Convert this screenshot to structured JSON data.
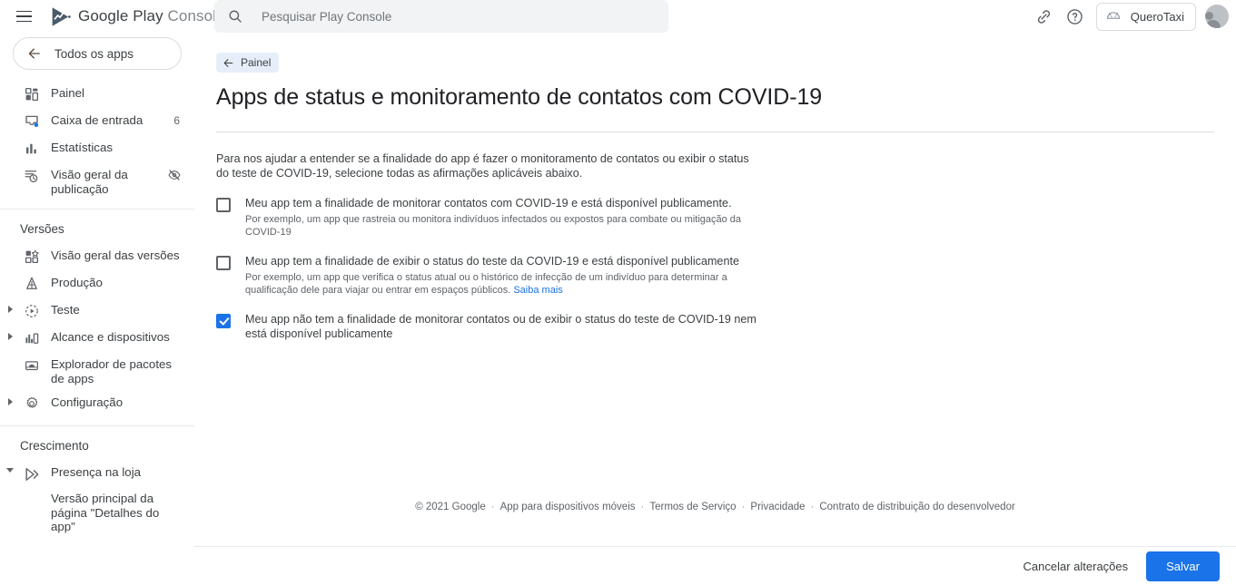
{
  "topbar": {
    "menu_icon": "hamburger-menu-icon",
    "brand_google_play": "Google Play",
    "brand_console": "Console",
    "logo_icon": "google-play-console-logo",
    "search": {
      "placeholder": "Pesquisar Play Console",
      "value": "",
      "icon": "search-icon"
    },
    "link_icon": "link-icon",
    "help_icon": "help-circle-icon",
    "app_chip": {
      "icon": "android-robot-icon",
      "name": "QueroTaxi"
    },
    "avatar": "user-avatar"
  },
  "sidebar": {
    "all_apps": {
      "label": "Todos os apps",
      "icon": "arrow-left-icon"
    },
    "primary_items": [
      {
        "label": "Painel",
        "icon": "dashboard-icon",
        "badge": "",
        "right_icon": "",
        "caret": ""
      },
      {
        "label": "Caixa de entrada",
        "icon": "inbox-icon",
        "badge": "6",
        "right_icon": "",
        "caret": ""
      },
      {
        "label": "Estatísticas",
        "icon": "bar-chart-icon",
        "badge": "",
        "right_icon": "",
        "caret": ""
      },
      {
        "label": "Visão geral da publicação",
        "icon": "publishing-clock-icon",
        "badge": "",
        "right_icon": "visibility-off-icon",
        "caret": ""
      }
    ],
    "releases_section_title": "Versões",
    "release_items": [
      {
        "label": "Visão geral das versões",
        "icon": "release-overview-icon",
        "caret": ""
      },
      {
        "label": "Produção",
        "icon": "production-icon",
        "caret": ""
      },
      {
        "label": "Teste",
        "icon": "testing-icon",
        "caret": "right"
      },
      {
        "label": "Alcance e dispositivos",
        "icon": "reach-devices-icon",
        "caret": "right"
      },
      {
        "label": "Explorador de pacotes de apps",
        "icon": "app-bundle-explorer-icon",
        "caret": ""
      },
      {
        "label": "Configuração",
        "icon": "gear-icon",
        "caret": "right"
      }
    ],
    "growth_section_title": "Crescimento",
    "growth_items": [
      {
        "label": "Presença na loja",
        "icon": "store-presence-icon",
        "caret": "down"
      }
    ],
    "growth_subitems": [
      {
        "label": "Versão principal da página \"Detalhes do app\""
      }
    ]
  },
  "main": {
    "breadcrumb": {
      "label": "Painel",
      "icon": "arrow-left-icon"
    },
    "page_title": "Apps de status e monitoramento de contatos com COVID-19",
    "intro": "Para nos ajudar a entender se a finalidade do app é fazer o monitoramento de contatos ou exibir o status do teste de COVID-19, selecione todas as afirmações aplicáveis abaixo.",
    "options": [
      {
        "label": "Meu app tem a finalidade de monitorar contatos com COVID-19 e está disponível publicamente.",
        "help": "Por exemplo, um app que rastreia ou monitora indivíduos infectados ou expostos para combate ou mitigação da COVID-19",
        "help_link": "",
        "checked": false
      },
      {
        "label": "Meu app tem a finalidade de exibir o status do teste da COVID-19 e está disponível publicamente",
        "help": "Por exemplo, um app que verifica o status atual ou o histórico de infecção de um indivíduo para determinar a qualificação dele para viajar ou entrar em espaços públicos.",
        "help_link": "Saiba mais",
        "checked": false
      },
      {
        "label": "Meu app não tem a finalidade de monitorar contatos ou de exibir o status do teste de COVID-19 nem está disponível publicamente",
        "help": "",
        "help_link": "",
        "checked": true
      }
    ],
    "footer": {
      "copyright": "© 2021 Google",
      "links": [
        "App para dispositivos móveis",
        "Termos de Serviço",
        "Privacidade",
        "Contrato de distribuição do desenvolvedor"
      ]
    }
  },
  "actionbar": {
    "cancel_label": "Cancelar alterações",
    "save_label": "Salvar"
  },
  "colors": {
    "accent": "#1a73e8",
    "breadcrumb_bg": "#e8eef9",
    "text": "#3c4043",
    "muted": "#5f6368"
  }
}
